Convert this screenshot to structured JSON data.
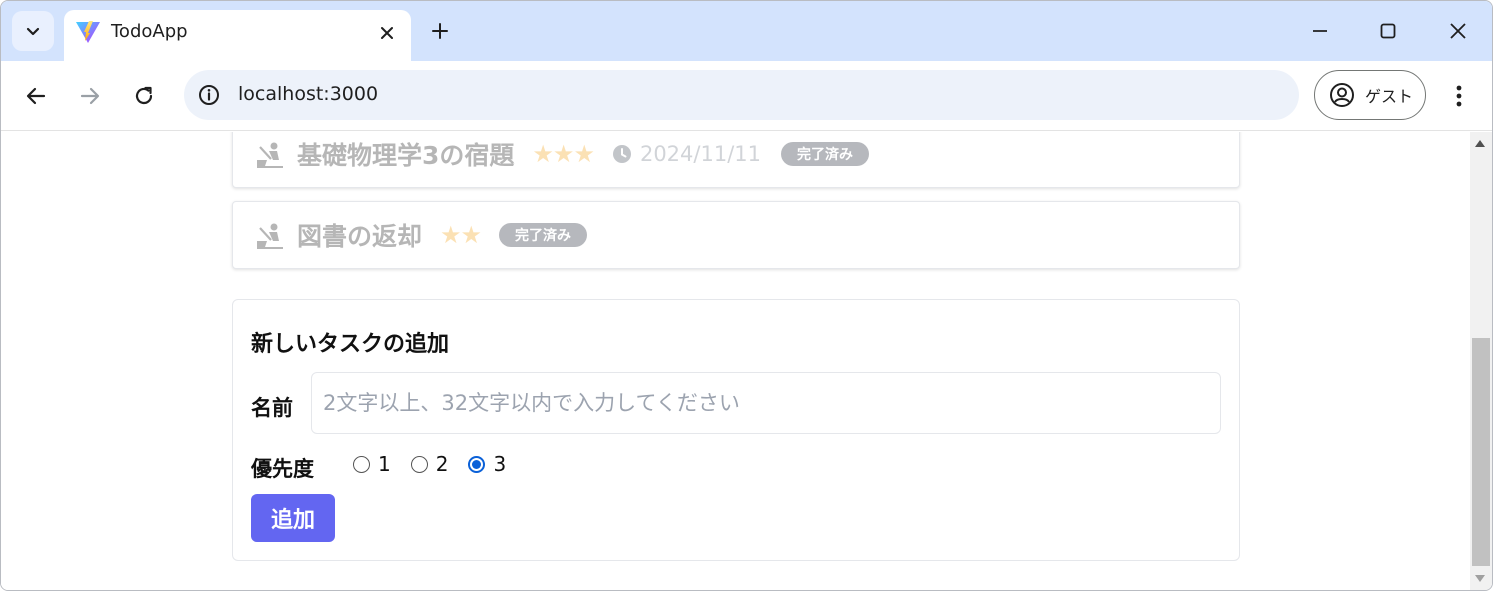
{
  "browser": {
    "tab_title": "TodoApp",
    "url": "localhost:3000",
    "profile_label": "ゲスト"
  },
  "tasks": [
    {
      "name": "基礎物理学3の宿題",
      "stars": "★★★",
      "priority": 3,
      "due": "2024/11/11",
      "status": "完了済み"
    },
    {
      "name": "図書の返却",
      "stars": "★★",
      "priority": 2,
      "status": "完了済み"
    }
  ],
  "form": {
    "title": "新しいタスクの追加",
    "name_label": "名前",
    "name_value": "",
    "name_placeholder": "2文字以上、32文字以内で入力してください",
    "priority_label": "優先度",
    "priority_options": [
      "1",
      "2",
      "3"
    ],
    "priority_selected": "3",
    "submit_label": "追加"
  },
  "colors": {
    "accent": "#6366f1",
    "star": "#f59e0b",
    "radio_checked": "#0b61d8",
    "tab_strip": "#d3e3fd"
  }
}
